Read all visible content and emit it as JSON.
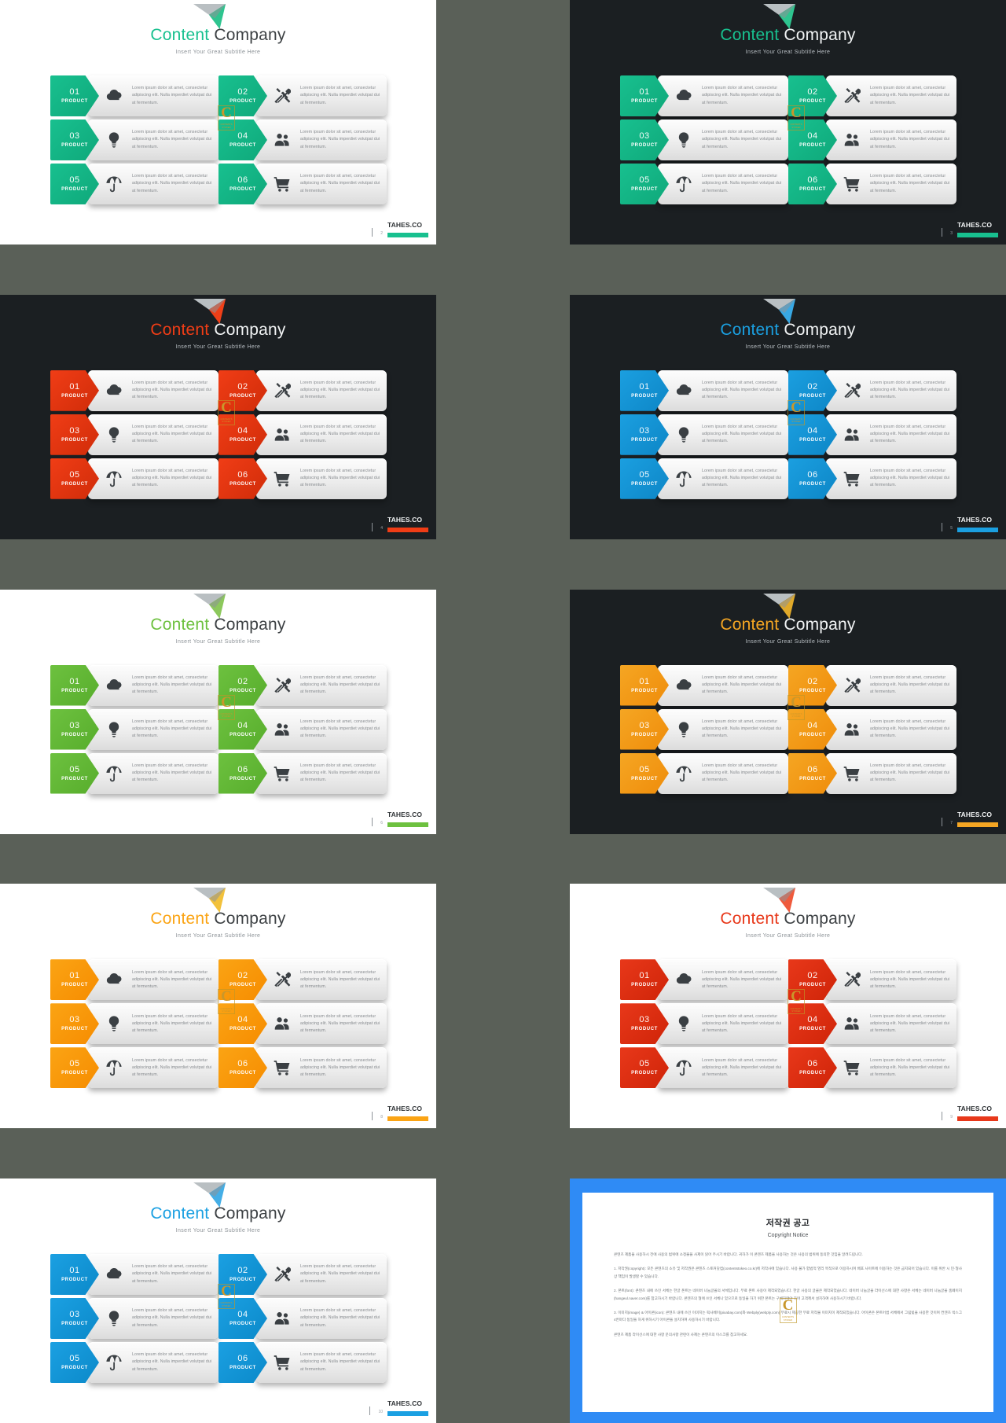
{
  "deck": {
    "title_part1": "Content",
    "title_part2": " Company",
    "subtitle": "Insert Your Great Subtitle Here",
    "brand": "TAHES.CO",
    "product_label": "PRODUCT",
    "body_text": "Lorem ipsum dolor sit amet, consectetur adipiscing elit. Nulla imperdiet volutpat dui at fermentum.",
    "badge_letter": "C",
    "badge_mini": "CONTENTS\nSTOKER"
  },
  "items": [
    {
      "num": "01",
      "label": "PRODUCT",
      "icon": "cloud-icon",
      "text": "Lorem ipsum dolor sit amet, consectetur adipiscing elit. Nulla imperdiet volutpat dui at fermentum."
    },
    {
      "num": "02",
      "label": "PRODUCT",
      "icon": "tools-icon",
      "text": "Lorem ipsum dolor sit amet, consectetur adipiscing elit. Nulla imperdiet volutpat dui at fermentum."
    },
    {
      "num": "03",
      "label": "PRODUCT",
      "icon": "bulb-icon",
      "text": "Lorem ipsum dolor sit amet, consectetur adipiscing elit. Nulla imperdiet volutpat dui at fermentum."
    },
    {
      "num": "04",
      "label": "PRODUCT",
      "icon": "people-icon",
      "text": "Lorem ipsum dolor sit amet, consectetur adipiscing elit. Nulla imperdiet volutpat dui at fermentum."
    },
    {
      "num": "05",
      "label": "PRODUCT",
      "icon": "umbrella-icon",
      "text": "Lorem ipsum dolor sit amet, consectetur adipiscing elit. Nulla imperdiet volutpat dui at fermentum."
    },
    {
      "num": "06",
      "label": "PRODUCT",
      "icon": "cart-icon",
      "text": "Lorem ipsum dolor sit amet, consectetur adipiscing elit. Nulla imperdiet volutpat dui at fermentum."
    }
  ],
  "slides": [
    {
      "page": "2",
      "theme": "light",
      "accent": "#18c08f",
      "accent2": "#0fa87a",
      "plane": "#2ec48f"
    },
    {
      "page": "3",
      "theme": "dark",
      "accent": "#18c08f",
      "accent2": "#0fa87a",
      "plane": "#2ec48f"
    },
    {
      "page": "4",
      "theme": "dark",
      "accent": "#f03d16",
      "accent2": "#d02c09",
      "plane": "#ef3f18"
    },
    {
      "page": "5",
      "theme": "dark",
      "accent": "#1b9fe0",
      "accent2": "#0d86c6",
      "plane": "#38a8e4"
    },
    {
      "page": "6",
      "theme": "light",
      "accent": "#6dc13f",
      "accent2": "#57ad2c",
      "plane": "#8cc85c"
    },
    {
      "page": "7",
      "theme": "dark",
      "accent": "#f5a623",
      "accent2": "#ef8c0a",
      "plane": "#e0a92a"
    },
    {
      "page": "8",
      "theme": "light",
      "accent": "#fba414",
      "accent2": "#f68c00",
      "plane": "#f2c13b"
    },
    {
      "page": "9",
      "theme": "light",
      "accent": "#e8381a",
      "accent2": "#cf2408",
      "plane": "#ef5a3c"
    },
    {
      "page": "10",
      "theme": "light",
      "accent": "#1ba0e2",
      "accent2": "#0b89c9",
      "plane": "#44aee6"
    }
  ],
  "copyright": {
    "title": "저작권 공고",
    "subtitle": "Copyright Notice",
    "paragraphs": [
      "콘텐츠 제품을 사용하시 전에 사용의 범위에 소정물을 사제이 읽어 주시기 바랍니다. 귀하가 이 콘텐츠 제품을 사용하는 것은 사용의 범위에 동의한 것임을 알려드립니다.",
      "1. 저작권(copyright): 모든 콘텐츠의 소유 및 저작권은 콘텐츠 스토커닷컴(contentstokeo.co.kr)에 저작사에 있습니다. 사용 불가 합법적 영리 목적으로 이용하시며 배포 사이트에 이용하는 것은 금지되어 있습니다. 이를 위반 시 민·형사상 책임이 발생할 수 있습니다.",
      "2. 폰트(font): 콘텐츠 내에 쓰인 서체는 한글 폰트는 네이버 나눔글꼴의 서체입니다. 무료 폰트 사용이 제작되었습니다. 한글 사용의 글꼴은 제작되었습니다. 네이버 나눔글꼴 라이선스에 대한 사항은 서체는 네이버 나눔글꼴 홈페이지(hangeul.naver.com)를 참고하시기 바랍니다. 콘텐츠의 형에 쓰인 서체나 있으므로 동일을 하기 위한 폰트는 구체하여야 하며 고객께서 설치하여 사용하시기 바랍니다.",
      "3. 이미지(image) & 아이콘(icon): 콘텐츠 내에 쓰인 이미지는 픽사베이(pixabay.com)와 Webply(webply.com) 무료시 제공한 무료 저작물 이미지이 제작되었습니다. 아이콘은 폰트어썸 서체에서 그림빛을 사용한 것이며 컨텐츠 박스그 4번마다 동일을 하게 위하시기 아이콘을 설치하여 사용하시기 바랍니다.",
      "콘텐츠 제품 라이선스에 대한 사항 문의사항 관련이 사제는 콘텐츠의 이스크를 참고하세요."
    ]
  }
}
